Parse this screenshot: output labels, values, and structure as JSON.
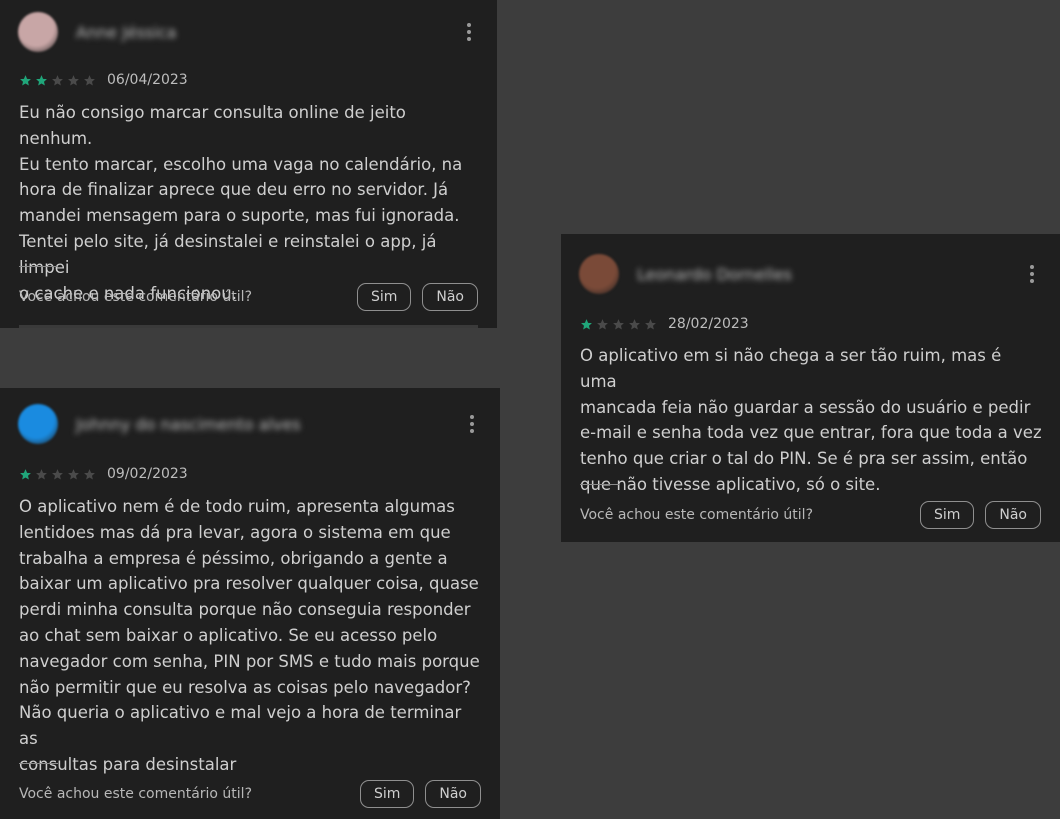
{
  "colors": {
    "background": "#3d3d3d",
    "card": "#1f1f1f",
    "star_filled": "#20a67a",
    "star_empty": "#4a4a4a"
  },
  "reviews": [
    {
      "author": "Anne Jéssica",
      "avatar_color": "#c8a6a6",
      "rating": 2,
      "max_rating": 5,
      "date": "06/04/2023",
      "lines": [
        "Eu não consigo marcar consulta online de jeito nenhum.",
        "Eu tento marcar, escolho uma vaga no calendário, na",
        "hora de finalizar aprece que deu erro no servidor. Já",
        "mandei mensagem para o suporte, mas fui ignorada.",
        "Tentei pelo site, já desinstalei e reinstalei o app, já limpei",
        "o cache e nada funcionou."
      ],
      "helpful_question": "Você achou este comentário útil?",
      "yes_label": "Sim",
      "no_label": "Não"
    },
    {
      "author": "Johnny do nascimento alves",
      "avatar_color": "#1a8be0",
      "rating": 1,
      "max_rating": 5,
      "date": "09/02/2023",
      "lines": [
        "O aplicativo nem é de todo ruim, apresenta algumas",
        "lentidoes mas dá pra levar, agora o sistema em que",
        "trabalha a empresa é péssimo, obrigando a gente a",
        "baixar um aplicativo pra resolver qualquer coisa, quase",
        "perdi minha consulta porque não conseguia responder",
        "ao chat sem baixar o aplicativo. Se eu acesso pelo",
        "navegador com senha, PIN por SMS e tudo mais porque",
        "não permitir que eu resolva as coisas pelo navegador?",
        "Não queria o aplicativo e mal vejo a hora de terminar as",
        "consultas para desinstalar"
      ],
      "helpful_question": "Você achou este comentário útil?",
      "yes_label": "Sim",
      "no_label": "Não"
    },
    {
      "author": "Leonardo Dornelles",
      "avatar_color": "#7a4a38",
      "rating": 1,
      "max_rating": 5,
      "date": "28/02/2023",
      "lines": [
        "O aplicativo em si não chega a ser tão ruim, mas é uma",
        "mancada feia não guardar a sessão do usuário e pedir",
        "e-mail e senha toda vez que entrar, fora que toda a vez",
        "tenho que criar o tal do PIN. Se é pra ser assim, então",
        "que não tivesse aplicativo, só o site."
      ],
      "helpful_question": "Você achou este comentário útil?",
      "yes_label": "Sim",
      "no_label": "Não"
    }
  ]
}
